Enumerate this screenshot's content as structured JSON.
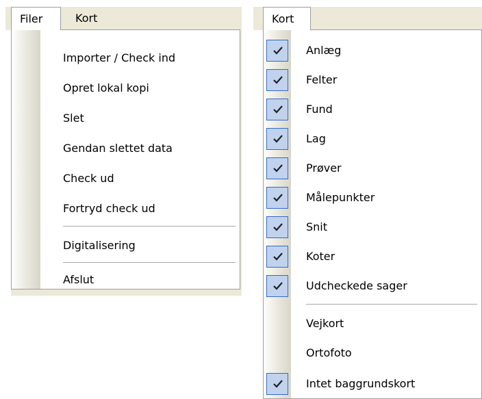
{
  "left_panel": {
    "menubar": {
      "filer": "Filer",
      "kort": "Kort"
    },
    "filer_menu": {
      "items": [
        {
          "label": "Importer / Check ind"
        },
        {
          "label": "Opret lokal kopi"
        },
        {
          "label": "Slet"
        },
        {
          "label": "Gendan slettet data"
        },
        {
          "label": "Check ud"
        },
        {
          "label": "Fortryd check ud"
        },
        {
          "label": "Digitalisering"
        },
        {
          "label": "Afslut"
        }
      ]
    }
  },
  "right_panel": {
    "menubar": {
      "kort": "Kort"
    },
    "kort_menu": {
      "items": [
        {
          "label": "Anlæg",
          "checked": true
        },
        {
          "label": "Felter",
          "checked": true
        },
        {
          "label": "Fund",
          "checked": true
        },
        {
          "label": "Lag",
          "checked": true
        },
        {
          "label": "Prøver",
          "checked": true
        },
        {
          "label": "Målepunkter",
          "checked": true
        },
        {
          "label": "Snit",
          "checked": true
        },
        {
          "label": "Koter",
          "checked": true
        },
        {
          "label": "Udcheckede sager",
          "checked": true
        },
        {
          "label": "Vejkort",
          "checked": false
        },
        {
          "label": "Ortofoto",
          "checked": false
        },
        {
          "label": "Intet baggrundskort",
          "checked": true
        }
      ]
    }
  },
  "colors": {
    "menu_bar": "#ece9d8",
    "check_highlight": "#c1d2ee",
    "check_border": "#316ac5"
  },
  "icons": {
    "check": "check-icon"
  }
}
